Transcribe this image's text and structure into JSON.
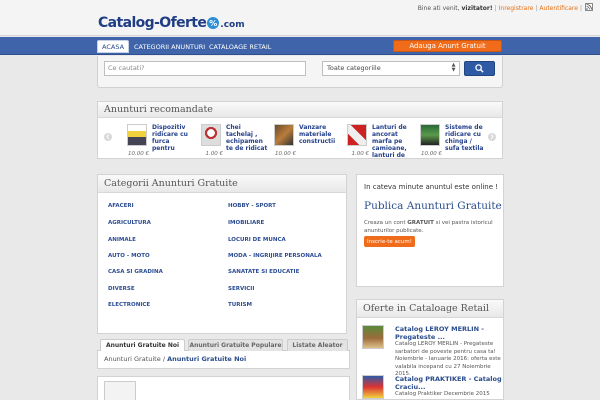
{
  "logo": {
    "name": "Catalog-Oferte",
    "badge": "%",
    "tld": ".com"
  },
  "topbar": {
    "welcome": "Bine ati venit,",
    "visitor": "vizitator!",
    "register": "Inregistrare",
    "login": "Autentificare"
  },
  "nav": {
    "home": "Acasa",
    "categories": "Categorii Anunturi",
    "retail": "Cataloage Retail",
    "add_button": "Adauga Anunt Gratuit"
  },
  "search": {
    "placeholder": "Ce cautati?",
    "category": "Toate categoriile"
  },
  "recommended": {
    "title": "Anunturi recomandate",
    "items": [
      {
        "title": "Dispozitiv ridicare cu furca pentru",
        "price": "10.00 €"
      },
      {
        "title": "Chei tachelaj , echipamen te de ridicat",
        "price": "1.00 €"
      },
      {
        "title": "Vanzare materiale constructii",
        "price": "10.00 €"
      },
      {
        "title": "Lanturi de ancorat marfa pe camioane, lanturi de",
        "price": "1.00 €"
      },
      {
        "title": "Sisteme de ridicare cu chinga / sufa textila",
        "price": "10.00 €"
      }
    ]
  },
  "categories": {
    "title": "Categorii Anunturi Gratuite",
    "left": [
      "Afaceri",
      "Agricultura",
      "Animale",
      "Auto - Moto",
      "Casa si gradina",
      "Diverse",
      "Electronice"
    ],
    "right": [
      "Hobby - Sport",
      "Imobiliare",
      "Locuri de munca",
      "Moda - Ingrijire personala",
      "Sanatate si educatie",
      "Servicii",
      "Turism"
    ]
  },
  "publish": {
    "line1": "In cateva minute anuntul este online !",
    "title": "Publica Anunturi Gratuite",
    "desc_pre": "Creaza un cont ",
    "desc_bold": "GRATUIT",
    "desc_post": " si vei pastra istoricul anunturilor publicate.",
    "button": "Inscrie-te acum!"
  },
  "offers": {
    "title": "Oferte in Cataloage Retail",
    "items": [
      {
        "title": "Catalog LEROY MERLIN - Pregateste ...",
        "desc": "Catalog LEROY MERLIN - Pregateste sarbatori de poveste pentru casa ta! Noiembrie - Ianuarie 2016: oferta este valabila incepand cu 27 Noiembrie 2015."
      },
      {
        "title": "Catalog PRAKTIKER - Catalog Craciu...",
        "desc": "Catalog Praktiker Decembrie 2015"
      }
    ]
  },
  "tabs": [
    "Anunturi Gratuite Noi",
    "Anunturi Gratuite Populare",
    "Listate Aleator"
  ],
  "breadcrumb": {
    "root": "Anunturi Gratuite",
    "sep": "/",
    "current": "Anunturi Gratuite Noi"
  },
  "colors": {
    "brand_blue": "#3f64a9",
    "accent_orange": "#f06b1a",
    "link_blue": "#2a4c8c"
  }
}
